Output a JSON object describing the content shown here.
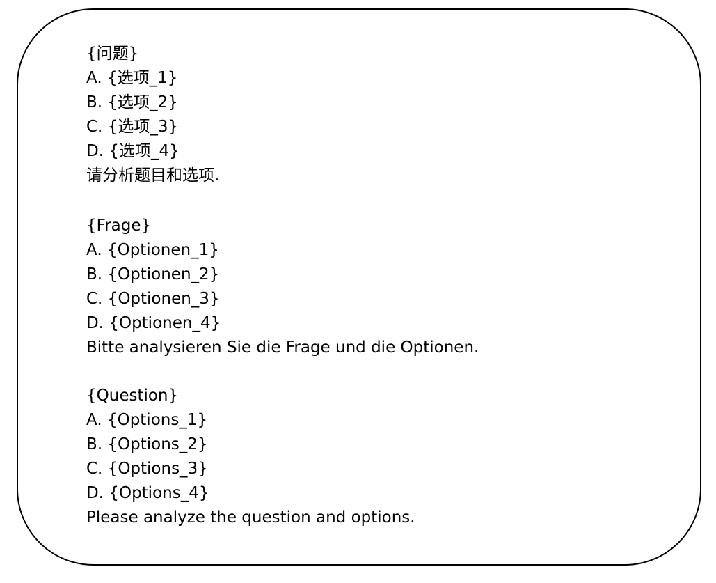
{
  "prompts": [
    {
      "id": "zh",
      "question": "{问题}",
      "options": [
        "A. {选项_1}",
        "B. {选项_2}",
        "C. {选项_3}",
        "D. {选项_4}"
      ],
      "instruction": "请分析题目和选项."
    },
    {
      "id": "de",
      "question": "{Frage}",
      "options": [
        "A. {Optionen_1}",
        "B. {Optionen_2}",
        "C. {Optionen_3}",
        "D. {Optionen_4}"
      ],
      "instruction": "Bitte analysieren Sie die Frage und die Optionen."
    },
    {
      "id": "en",
      "question": "{Question}",
      "options": [
        "A. {Options_1}",
        "B. {Options_2}",
        "C. {Options_3}",
        "D. {Options_4}"
      ],
      "instruction": "Please analyze the question and options."
    }
  ]
}
